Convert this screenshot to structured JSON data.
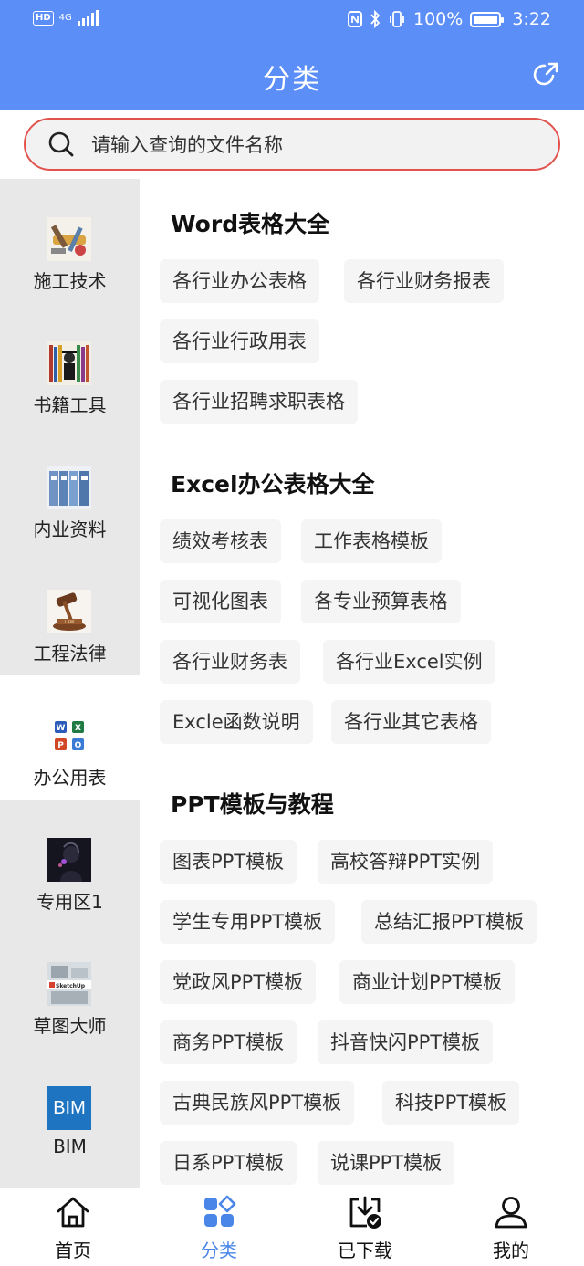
{
  "status_bar": {
    "hd": "HD",
    "network": "4G",
    "battery": "100%",
    "time": "3:22"
  },
  "header": {
    "title": "分类"
  },
  "search": {
    "placeholder": "请输入查询的文件名称"
  },
  "sidebar": {
    "items": [
      {
        "label": "施工技术",
        "icon": "construction-tools-image"
      },
      {
        "label": "书籍工具",
        "icon": "books-image"
      },
      {
        "label": "内业资料",
        "icon": "binders-image"
      },
      {
        "label": "工程法律",
        "icon": "gavel-image"
      },
      {
        "label": "办公用表",
        "icon": "office-apps-image"
      },
      {
        "label": "专用区1",
        "icon": "portrait-image"
      },
      {
        "label": "草图大师",
        "icon": "sketchup-image"
      },
      {
        "label": "BIM",
        "icon": "bim-logo",
        "logo_text": "BIM"
      }
    ],
    "active_index": 4
  },
  "sections": [
    {
      "title": "Word表格大全",
      "tags": [
        "各行业办公表格",
        "各行业财务报表",
        "各行业行政用表",
        "各行业招聘求职表格"
      ]
    },
    {
      "title": "Excel办公表格大全",
      "tags": [
        "绩效考核表",
        "工作表格模板",
        "可视化图表",
        "各专业预算表格",
        "各行业财务表",
        "各行业Excel实例",
        "Excle函数说明",
        "各行业其它表格"
      ]
    },
    {
      "title": "PPT模板与教程",
      "tags": [
        "图表PPT模板",
        "高校答辩PPT实例",
        "学生专用PPT模板",
        "总结汇报PPT模板",
        "党政风PPT模板",
        "商业计划PPT模板",
        "商务PPT模板",
        "抖音快闪PPT模板",
        "古典民族风PPT模板",
        "科技PPT模板",
        "日系PPT模板",
        "说课PPT模板"
      ]
    }
  ],
  "bottom_nav": {
    "items": [
      {
        "label": "首页",
        "icon": "home-icon"
      },
      {
        "label": "分类",
        "icon": "category-icon"
      },
      {
        "label": "已下载",
        "icon": "downloaded-icon"
      },
      {
        "label": "我的",
        "icon": "profile-icon"
      }
    ],
    "active_index": 1
  },
  "colors": {
    "header_bg": "#5b8ef7",
    "search_border": "#e2534d",
    "sidebar_bg": "#e8e8e8",
    "active_nav": "#4a86e8"
  }
}
